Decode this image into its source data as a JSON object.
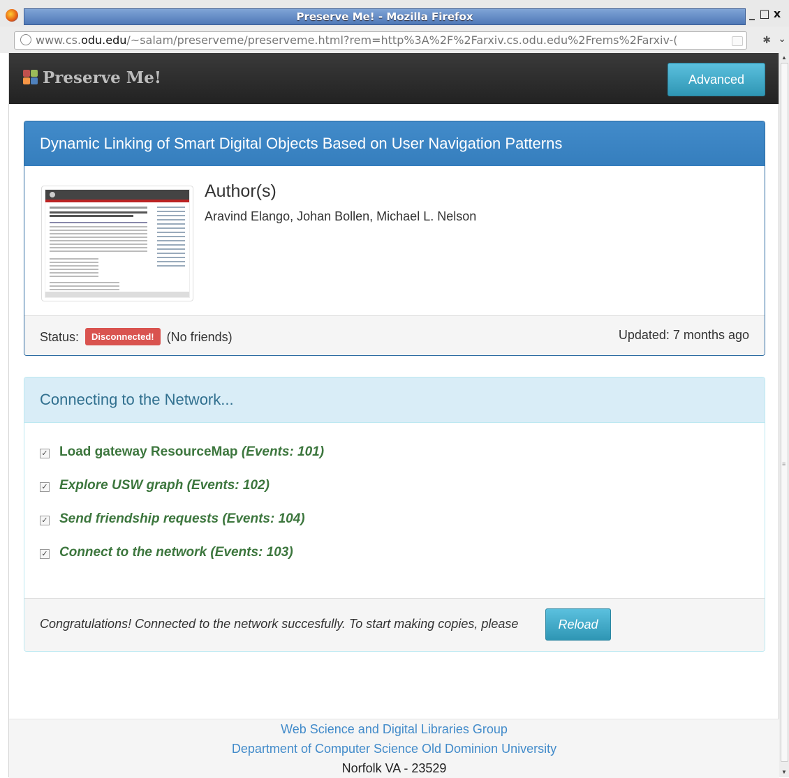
{
  "window": {
    "title": "Preserve Me! - Mozilla Firefox",
    "controls": [
      "_",
      "□",
      "x"
    ]
  },
  "urlbar": {
    "prefix": "www.cs.",
    "domain": "odu.edu",
    "path": "/~salam/preserveme/preserveme.html?rem=http%3A%2F%2Farxiv.cs.odu.edu%2Frems%2Farxiv-("
  },
  "navbar": {
    "brand": "Preserve Me!",
    "advanced_label": "Advanced"
  },
  "object_panel": {
    "title": "Dynamic Linking of Smart Digital Objects Based on User Navigation Patterns",
    "author_heading": "Author(s)",
    "authors": "Aravind Elango, Johan Bollen, Michael L. Nelson",
    "status_label": "Status:",
    "status_badge": "Disconnected!",
    "friends": "(No friends)",
    "updated": "Updated: 7 months ago"
  },
  "network_panel": {
    "title": "Connecting to the Network...",
    "tasks": [
      {
        "label": "Load gateway ResourceMap",
        "events": "(Events: 101)",
        "checked": true
      },
      {
        "label": "Explore USW graph",
        "events": "(Events: 102)",
        "checked": true
      },
      {
        "label": "Send friendship requests",
        "events": "(Events: 104)",
        "checked": true
      },
      {
        "label": "Connect to the network",
        "events": "(Events: 103)",
        "checked": true
      }
    ],
    "message": "Congratulations! Connected to the network succesfully. To start making copies, please",
    "reload_label": "Reload"
  },
  "footer": {
    "group": "Web Science and Digital Libraries Group",
    "department": "Department of Computer Science Old Dominion University",
    "address": "Norfolk VA - 23529"
  },
  "colors": {
    "primary": "#428bca",
    "info": "#5bc0de",
    "danger": "#d9534f",
    "success_text": "#3c763d",
    "navbar": "#222222"
  }
}
